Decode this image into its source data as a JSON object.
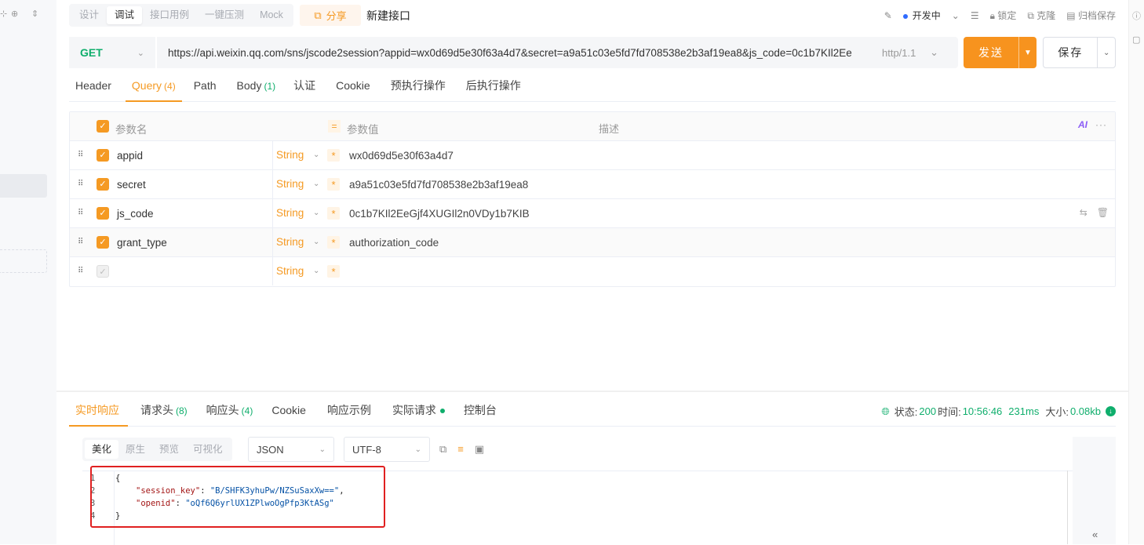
{
  "left_icons": [
    "filter-icon",
    "locate-icon",
    "sort-icon"
  ],
  "mode_tabs": [
    {
      "label": "设计",
      "active": false
    },
    {
      "label": "调试",
      "active": true
    },
    {
      "label": "接口用例",
      "active": false
    },
    {
      "label": "一键压测",
      "active": false
    },
    {
      "label": "Mock",
      "active": false
    }
  ],
  "share_label": "分享",
  "api_name": "新建接口",
  "top_right": {
    "status": "开发中",
    "lock": "锁定",
    "clone": "克隆",
    "archive": "归档保存"
  },
  "request": {
    "method": "GET",
    "url": "https://api.weixin.qq.com/sns/jscode2session?appid=wx0d69d5e30f63a4d7&secret=a9a51c03e5fd7fd708538e2b3af19ea8&js_code=0c1b7KIl2Ee",
    "http_version": "http/1.1",
    "send_label": "发送",
    "save_label": "保存"
  },
  "req_tabs": [
    {
      "label": "Header",
      "count": ""
    },
    {
      "label": "Query",
      "count": "(4)"
    },
    {
      "label": "Path",
      "count": ""
    },
    {
      "label": "Body",
      "count": "(1)"
    },
    {
      "label": "认证",
      "count": ""
    },
    {
      "label": "Cookie",
      "count": ""
    },
    {
      "label": "预执行操作",
      "count": ""
    },
    {
      "label": "后执行操作",
      "count": ""
    }
  ],
  "params": {
    "headers": {
      "name": "参数名",
      "value": "参数值",
      "desc": "描述",
      "ai": "AI"
    },
    "rows": [
      {
        "name": "appid",
        "type": "String",
        "value": "wx0d69d5e30f63a4d7"
      },
      {
        "name": "secret",
        "type": "String",
        "value": "a9a51c03e5fd7fd708538e2b3af19ea8"
      },
      {
        "name": "js_code",
        "type": "String",
        "value": "0c1b7KIl2EeGjf4XUGIl2n0VDy1b7KIB"
      },
      {
        "name": "grant_type",
        "type": "String",
        "value": "authorization_code"
      },
      {
        "name": "",
        "type": "String",
        "value": ""
      }
    ]
  },
  "resp_tabs": [
    {
      "label": "实时响应",
      "count": ""
    },
    {
      "label": "请求头",
      "count": "(8)"
    },
    {
      "label": "响应头",
      "count": "(4)"
    },
    {
      "label": "Cookie",
      "count": ""
    },
    {
      "label": "响应示例",
      "count": ""
    },
    {
      "label": "实际请求",
      "count": ""
    },
    {
      "label": "控制台",
      "count": ""
    }
  ],
  "resp_status": {
    "status_label": "状态:",
    "status": "200",
    "time_label": "时间:",
    "time": "10:56:46",
    "duration": "231ms",
    "size_label": "大小:",
    "size": "0.08kb"
  },
  "fmt_tabs": [
    {
      "label": "美化",
      "active": true
    },
    {
      "label": "原生",
      "active": false
    },
    {
      "label": "预览",
      "active": false
    },
    {
      "label": "可视化",
      "active": false
    }
  ],
  "format_select": "JSON",
  "encoding_select": "UTF-8",
  "code": {
    "line_numbers": [
      "1",
      "2",
      "3",
      "4"
    ],
    "open": "{",
    "close": "}",
    "k1": "\"session_key\"",
    "v1": "\"B/SHFK3yhuPw/NZSuSaxXw==\"",
    "k2": "\"openid\"",
    "v2": "\"oQf6Q6yrlUX1ZPlwoOgPfp3KtASg\""
  },
  "colors": {
    "accent": "#f59a23",
    "method": "#0fae6c",
    "success": "#0fae6c",
    "highlight_box": "#e02020"
  }
}
